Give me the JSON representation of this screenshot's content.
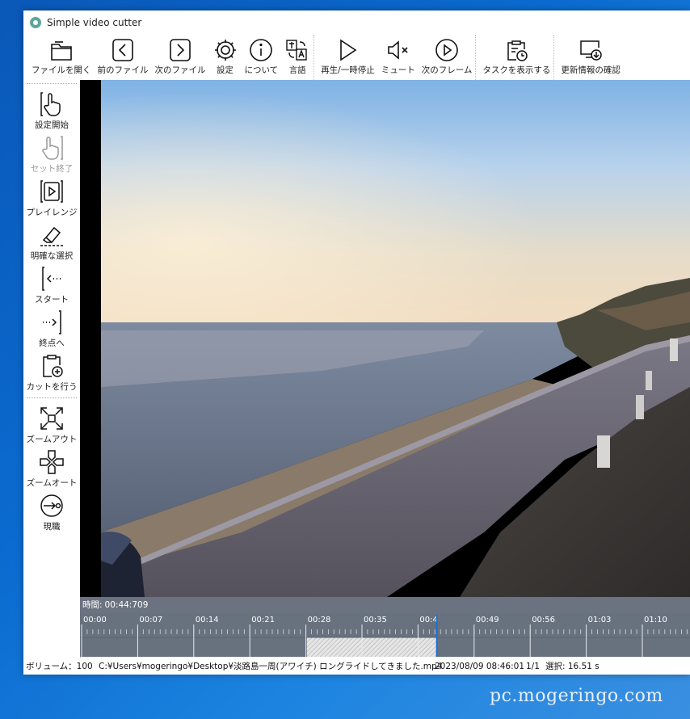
{
  "window": {
    "title": "Simple video cutter"
  },
  "toolbar": {
    "open_file": "ファイルを開く",
    "prev_file": "前のファイル",
    "next_file": "次のファイル",
    "settings": "設定",
    "about": "について",
    "language": "言語",
    "play_pause": "再生/一時停止",
    "mute": "ミュート",
    "next_frame": "次のフレーム",
    "show_tasks": "タスクを表示する",
    "check_updates": "更新情報の確認"
  },
  "sidebar": {
    "set_start": "設定開始",
    "set_end": "セット終了",
    "play_range": "プレイレンジ",
    "clear_selection": "明確な選択",
    "to_start": "スタート",
    "to_end": "終点へ",
    "do_cut": "カットを行う",
    "zoom_out": "ズームアウト",
    "zoom_auto": "ズームオート",
    "current": "現職"
  },
  "timeline": {
    "time_label": "時間:",
    "current_time": "00:44:709",
    "ticks": [
      "00:00",
      "00:07",
      "00:14",
      "00:21",
      "00:28",
      "00:35",
      "00:4",
      "00:49",
      "00:56",
      "01:03",
      "01:10"
    ],
    "playhead_fraction": 0.585,
    "selection_start_fraction": 0.372,
    "selection_end_fraction": 0.585
  },
  "status": {
    "volume": "ボリューム：100",
    "path": "C:¥Users¥mogeringo¥Desktop¥淡路島一周(アワイチ) ロングライドしてきました.mp4",
    "datetime": "2023/08/09 08:46:01",
    "count": "1/1",
    "selection": "選択: 16.51 s"
  },
  "watermark": "pc.mogeringo.com",
  "colors": {
    "timeline_bg": "#68717e",
    "playhead": "#1a6fd8",
    "desktop": "#0b6bd0"
  }
}
